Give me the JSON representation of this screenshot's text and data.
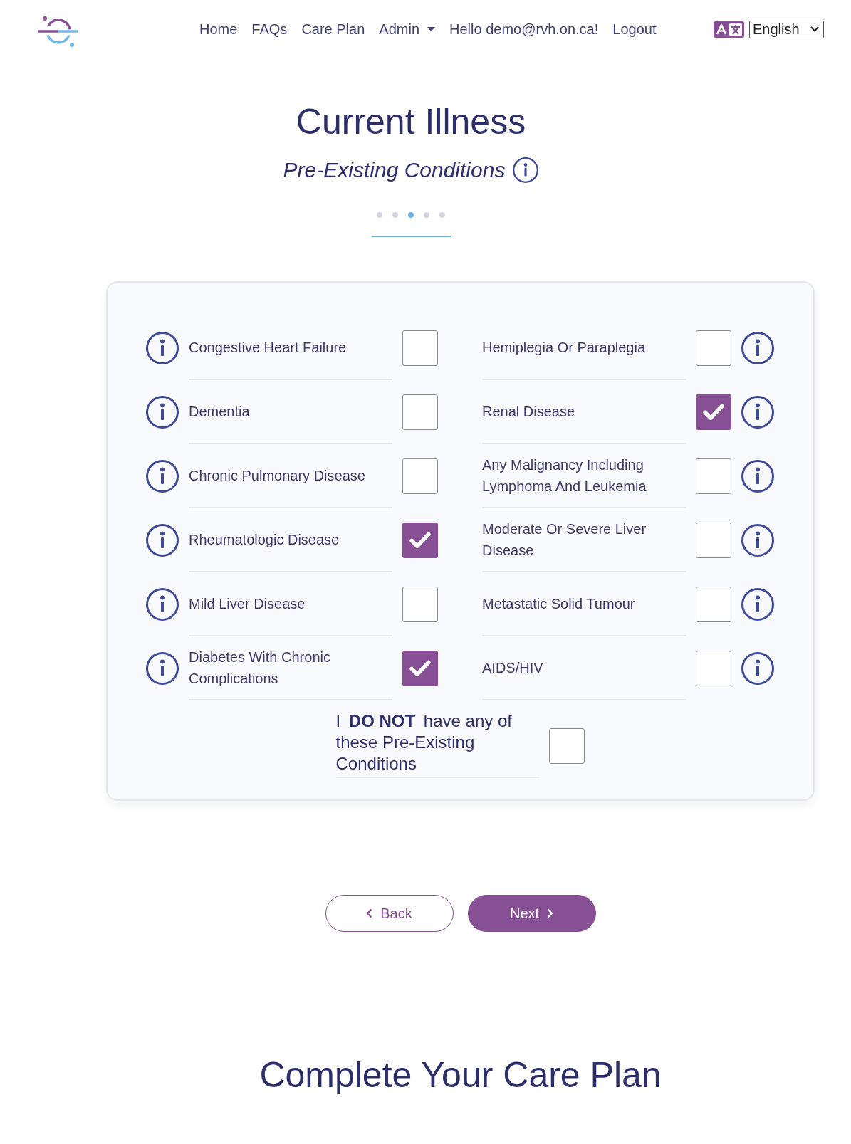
{
  "header": {
    "nav": [
      {
        "label": "Home",
        "kind": "link"
      },
      {
        "label": "FAQs",
        "kind": "link"
      },
      {
        "label": "Care Plan",
        "kind": "link"
      },
      {
        "label": "Admin",
        "kind": "dropdown"
      },
      {
        "label": "Hello demo@rvh.on.ca!",
        "kind": "link"
      },
      {
        "label": "Logout",
        "kind": "link"
      }
    ],
    "language": {
      "value": "English"
    }
  },
  "page": {
    "title": "Current Illness",
    "subtitle": "Pre-Existing Conditions"
  },
  "steps": [
    {
      "selected": false
    },
    {
      "selected": false
    },
    {
      "selected": true
    },
    {
      "selected": false
    },
    {
      "selected": false
    }
  ],
  "left_column": [
    {
      "label": "Congestive Heart Failure",
      "checked": false
    },
    {
      "label": "Dementia",
      "checked": false
    },
    {
      "label": "Chronic Pulmonary Disease",
      "checked": false
    },
    {
      "label": "Rheumatologic Disease",
      "checked": true
    },
    {
      "label": "Mild Liver Disease",
      "checked": false
    },
    {
      "label": "Diabetes With Chronic Complications",
      "checked": true
    }
  ],
  "right_column": [
    {
      "label": "Hemiplegia Or Paraplegia",
      "checked": false
    },
    {
      "label": "Renal Disease",
      "checked": true
    },
    {
      "label": "Any Malignancy Including Lymphoma And Leukemia",
      "checked": false
    },
    {
      "label": "Moderate Or Severe Liver Disease",
      "checked": false
    },
    {
      "label": "Metastatic Solid Tumour",
      "checked": false
    },
    {
      "label": "AIDS/HIV",
      "checked": false
    }
  ],
  "none_option": {
    "label": "I **DO NOT** have any of these Pre-Existing Conditions",
    "checked": false
  },
  "buttons": [
    {
      "label": "Back",
      "kind": "back"
    },
    {
      "label": "Next",
      "kind": "next"
    }
  ],
  "next_section": {
    "title": "Complete Your Care Plan"
  }
}
